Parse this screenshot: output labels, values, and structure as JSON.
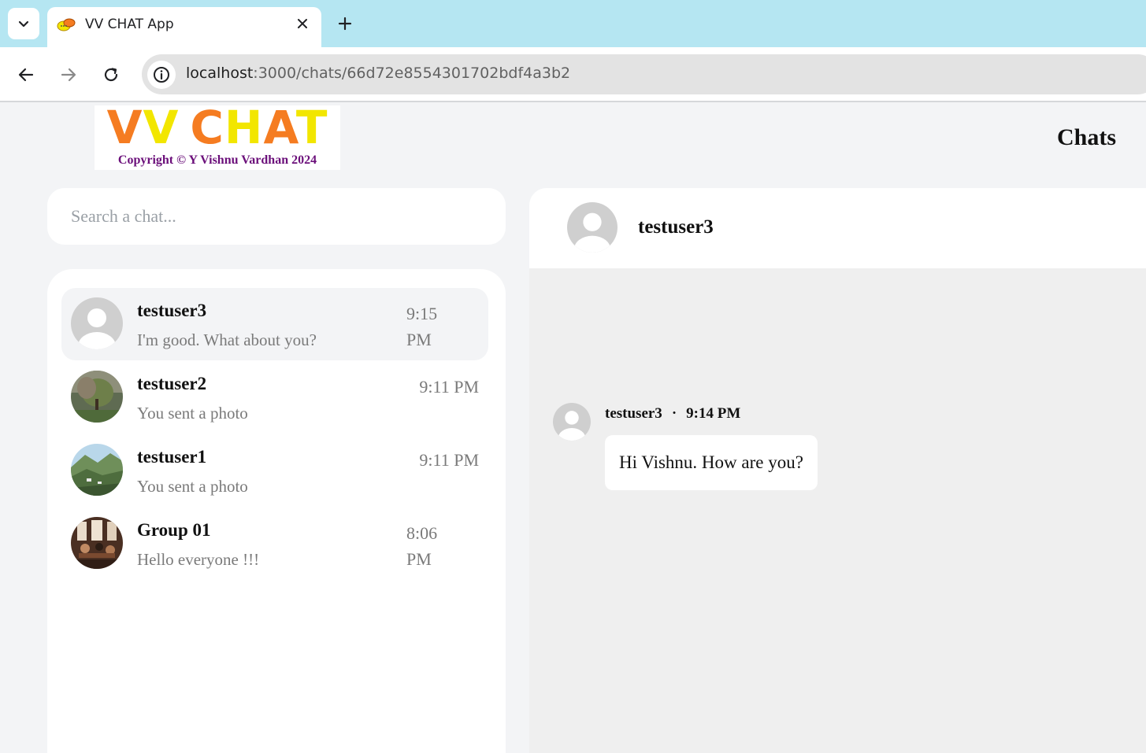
{
  "browser": {
    "tab_title": "VV CHAT App",
    "url_host": "localhost",
    "url_path": ":3000/chats/66d72e8554301702bdf4a3b2"
  },
  "header": {
    "logo_vv": "VV",
    "logo_chat": "CHAT",
    "logo_copyright": "Copyright © Y Vishnu Vardhan 2024",
    "page_title": "Chats"
  },
  "search": {
    "placeholder": "Search a chat..."
  },
  "chats": [
    {
      "name": "testuser3",
      "last_message": "I'm good. What about you?",
      "time": "9:15 PM",
      "active": true,
      "avatar": "default-avatar"
    },
    {
      "name": "testuser2",
      "last_message": "You sent a photo",
      "time": "9:11 PM",
      "active": false,
      "avatar": "tree-photo"
    },
    {
      "name": "testuser1",
      "last_message": "You sent a photo",
      "time": "9:11 PM",
      "active": false,
      "avatar": "mountain-photo"
    },
    {
      "name": "Group 01",
      "last_message": "Hello everyone !!!",
      "time": "8:06 PM",
      "active": false,
      "avatar": "cafe-photo"
    }
  ],
  "conversation": {
    "name": "testuser3",
    "messages": [
      {
        "sender": "testuser3",
        "time": "9:14 PM",
        "text": "Hi Vishnu. How are you?"
      }
    ]
  },
  "colors": {
    "logo_orange": "#f57c21",
    "logo_yellow": "#f2e600",
    "copyright_purple": "#6b0f7a",
    "tabbar": "#b5e6f2"
  }
}
